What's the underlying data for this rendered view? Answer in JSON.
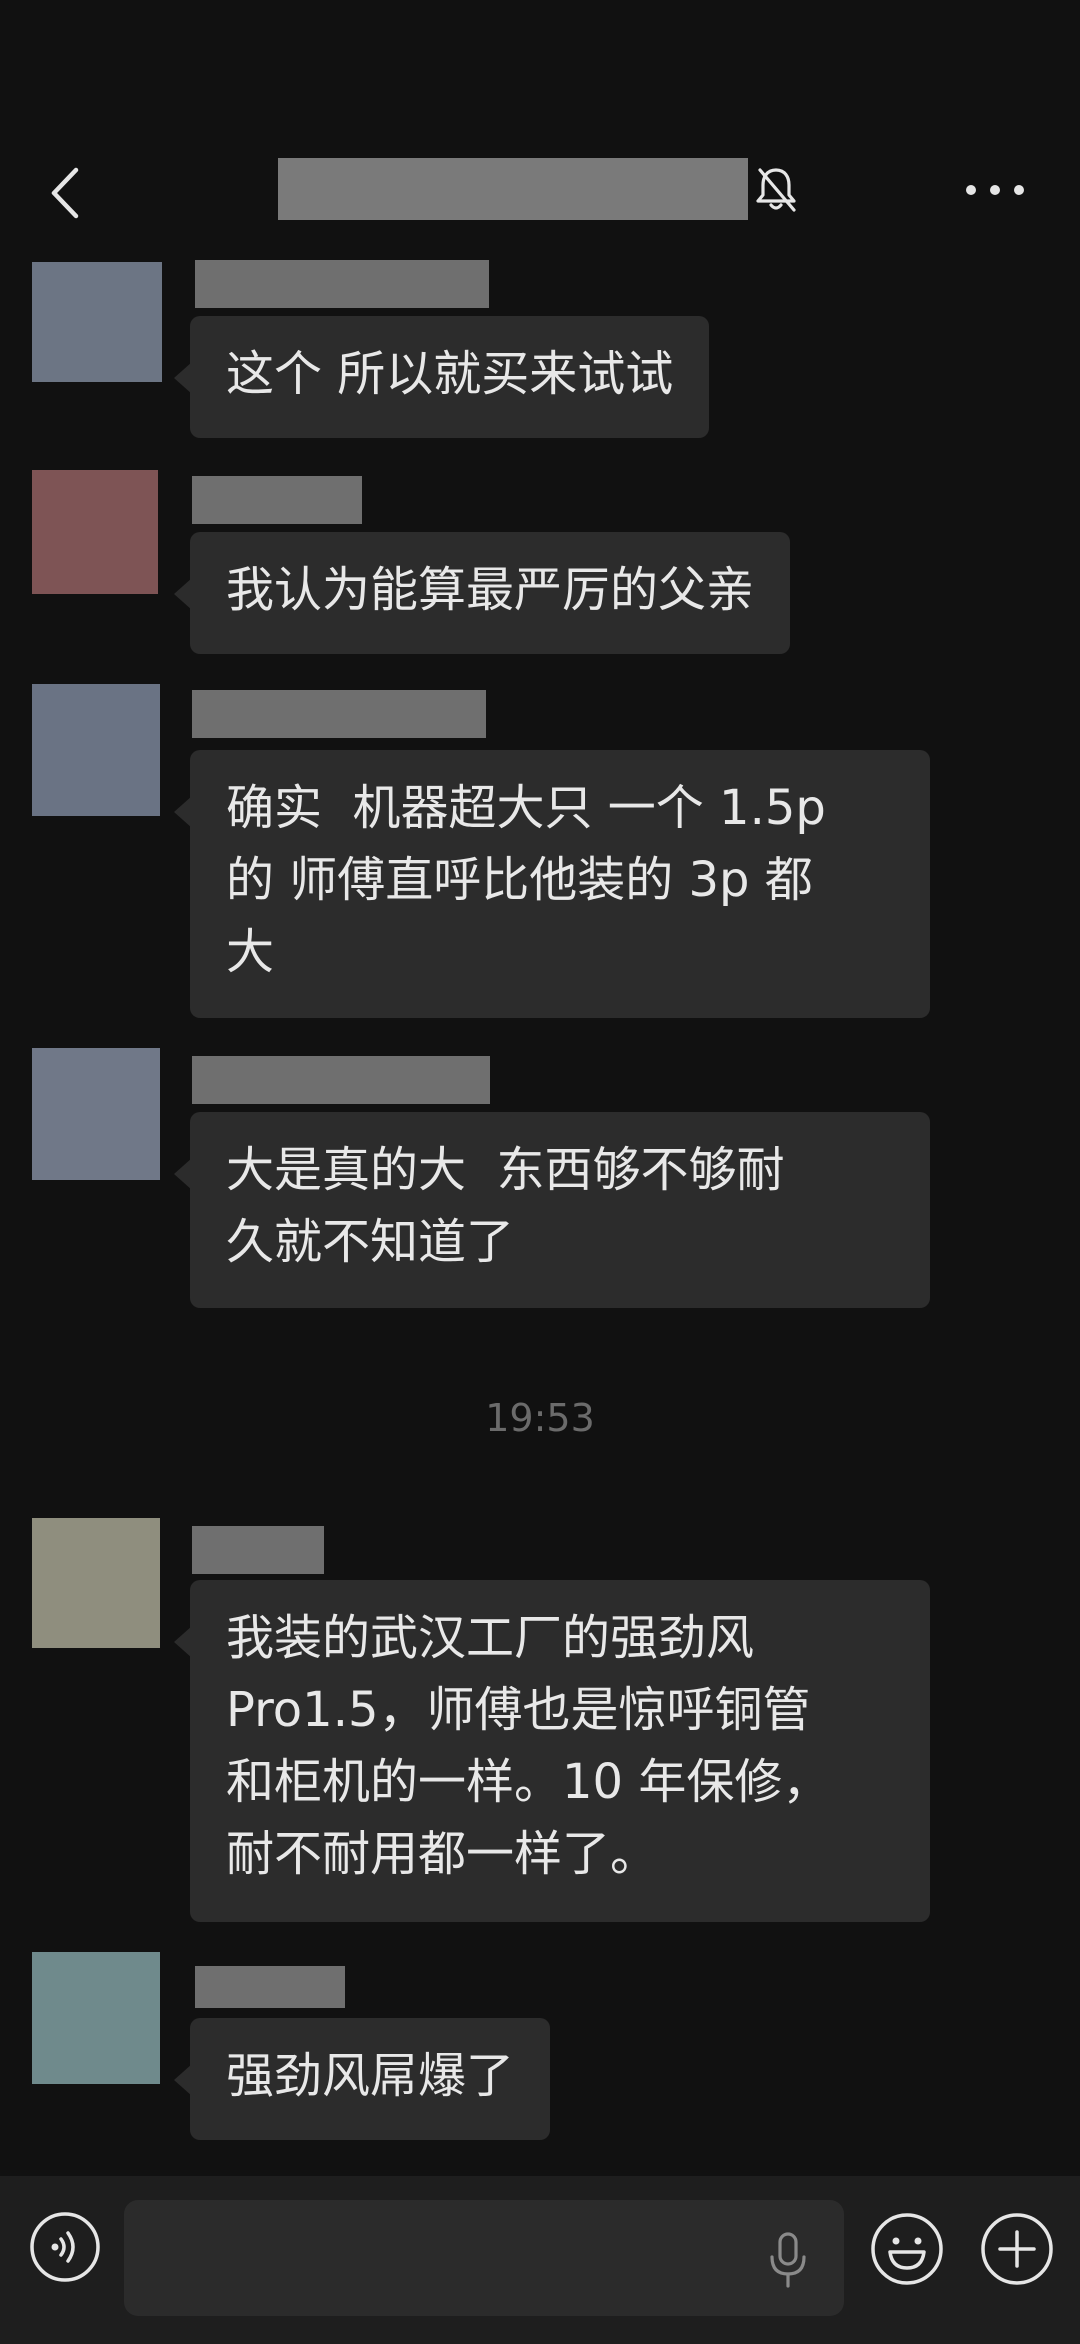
{
  "header": {
    "back_icon": "chevron-left-icon",
    "mute_icon": "bell-off-icon",
    "more_icon": "more-dots-icon"
  },
  "messages": [
    {
      "text": "这个 所以就买来试试",
      "avatar_color": "#6c7584"
    },
    {
      "text": "我认为能算最严厉的父亲",
      "avatar_color": "#7e5455"
    },
    {
      "text": "确实  机器超大只 一个 1.5p\n的 师傅直呼比他装的 3p 都\n大",
      "avatar_color": "#6a7384"
    },
    {
      "text": "大是真的大  东西够不够耐\n久就不知道了",
      "avatar_color": "#707888"
    },
    {
      "text": "我装的武汉工厂的强劲风\nPro1.5，师傅也是惊呼铜管\n和柜机的一样。10 年保修，\n耐不耐用都一样了。",
      "avatar_color": "#8f8e7e"
    },
    {
      "text": "强劲风屌爆了",
      "avatar_color": "#6f8a8c"
    }
  ],
  "timestamp": "19:53",
  "input_bar": {
    "voice_icon": "voice-mode-icon",
    "mic_icon": "microphone-icon",
    "emoji_icon": "emoji-icon",
    "plus_icon": "plus-icon",
    "text_value": ""
  }
}
